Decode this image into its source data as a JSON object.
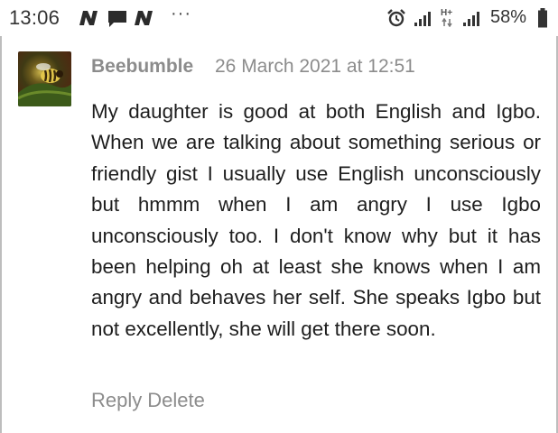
{
  "statusbar": {
    "time": "13:06",
    "notifications": [
      "news-app-icon",
      "message-icon",
      "news-app-icon"
    ],
    "overflow": "···",
    "battery_percent": "58%",
    "network_label": "H+"
  },
  "comment": {
    "author": "Beebumble",
    "timestamp": "26 March 2021 at 12:51",
    "body": "My daughter is good at both English and Igbo. When we are talking about something serious or friendly gist I usually use English unconsciously but hmmm when I am angry I use Igbo unconsciously too. I don't know why but it has been helping oh at least she knows when I am angry and behaves her self. She speaks Igbo but not excellently, she will get there soon.",
    "reply_label": "Reply",
    "delete_label": "Delete"
  },
  "colors": {
    "meta_gray": "#8c8c8c",
    "body_text": "#1e1e1e",
    "frame": "#bdbdbd"
  }
}
